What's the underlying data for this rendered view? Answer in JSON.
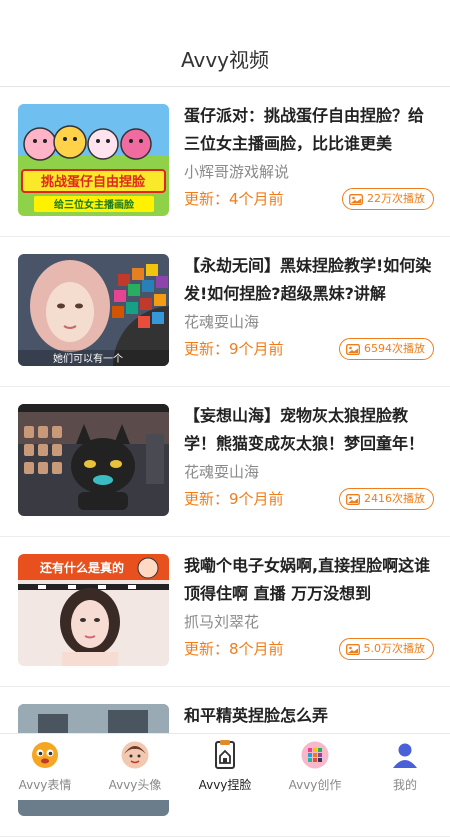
{
  "header": {
    "title": "Avvy视频"
  },
  "videos": [
    {
      "title": "蛋仔派对：挑战蛋仔自由捏脸？给三位女主播画脸，比比谁更美",
      "author": "小辉哥游戏解说",
      "updated": "更新：4个月前",
      "plays": "22万次播放",
      "thumb_text": [
        "挑战蛋仔自由捏脸",
        "给三位女主播画脸"
      ]
    },
    {
      "title": "【永劫无间】黑妹捏脸教学!如何染发!如何捏脸?超级黑妹?讲解",
      "author": "花魂耍山海",
      "updated": "更新：9个月前",
      "plays": "6594次播放",
      "thumb_text": [
        "她们可以有一个"
      ]
    },
    {
      "title": "【妄想山海】宠物灰太狼捏脸教学！熊猫变成灰太狼！梦回童年！",
      "author": "花魂耍山海",
      "updated": "更新：9个月前",
      "plays": "2416次播放",
      "thumb_text": []
    },
    {
      "title": "我嘞个电子女娲啊,直接捏脸啊这谁顶得住啊 直播 万万没想到",
      "author": "抓马刘翠花",
      "updated": "更新：8个月前",
      "plays": "5.0万次播放",
      "thumb_text": [
        "还有什么是真的"
      ]
    },
    {
      "title": "和平精英捏脸怎么弄",
      "author": "",
      "updated": "",
      "plays": "",
      "thumb_text": []
    }
  ],
  "tabs": [
    {
      "label": "Avvy表情",
      "icon": "emoji-face-icon"
    },
    {
      "label": "Avvy头像",
      "icon": "avatar-icon"
    },
    {
      "label": "Avvy捏脸",
      "icon": "face-edit-icon",
      "active": true
    },
    {
      "label": "Avvy创作",
      "icon": "create-grid-icon"
    },
    {
      "label": "我的",
      "icon": "profile-icon"
    }
  ],
  "colors": {
    "accent": "#f07d1a",
    "title": "#222222",
    "muted": "#8a8a8a"
  }
}
